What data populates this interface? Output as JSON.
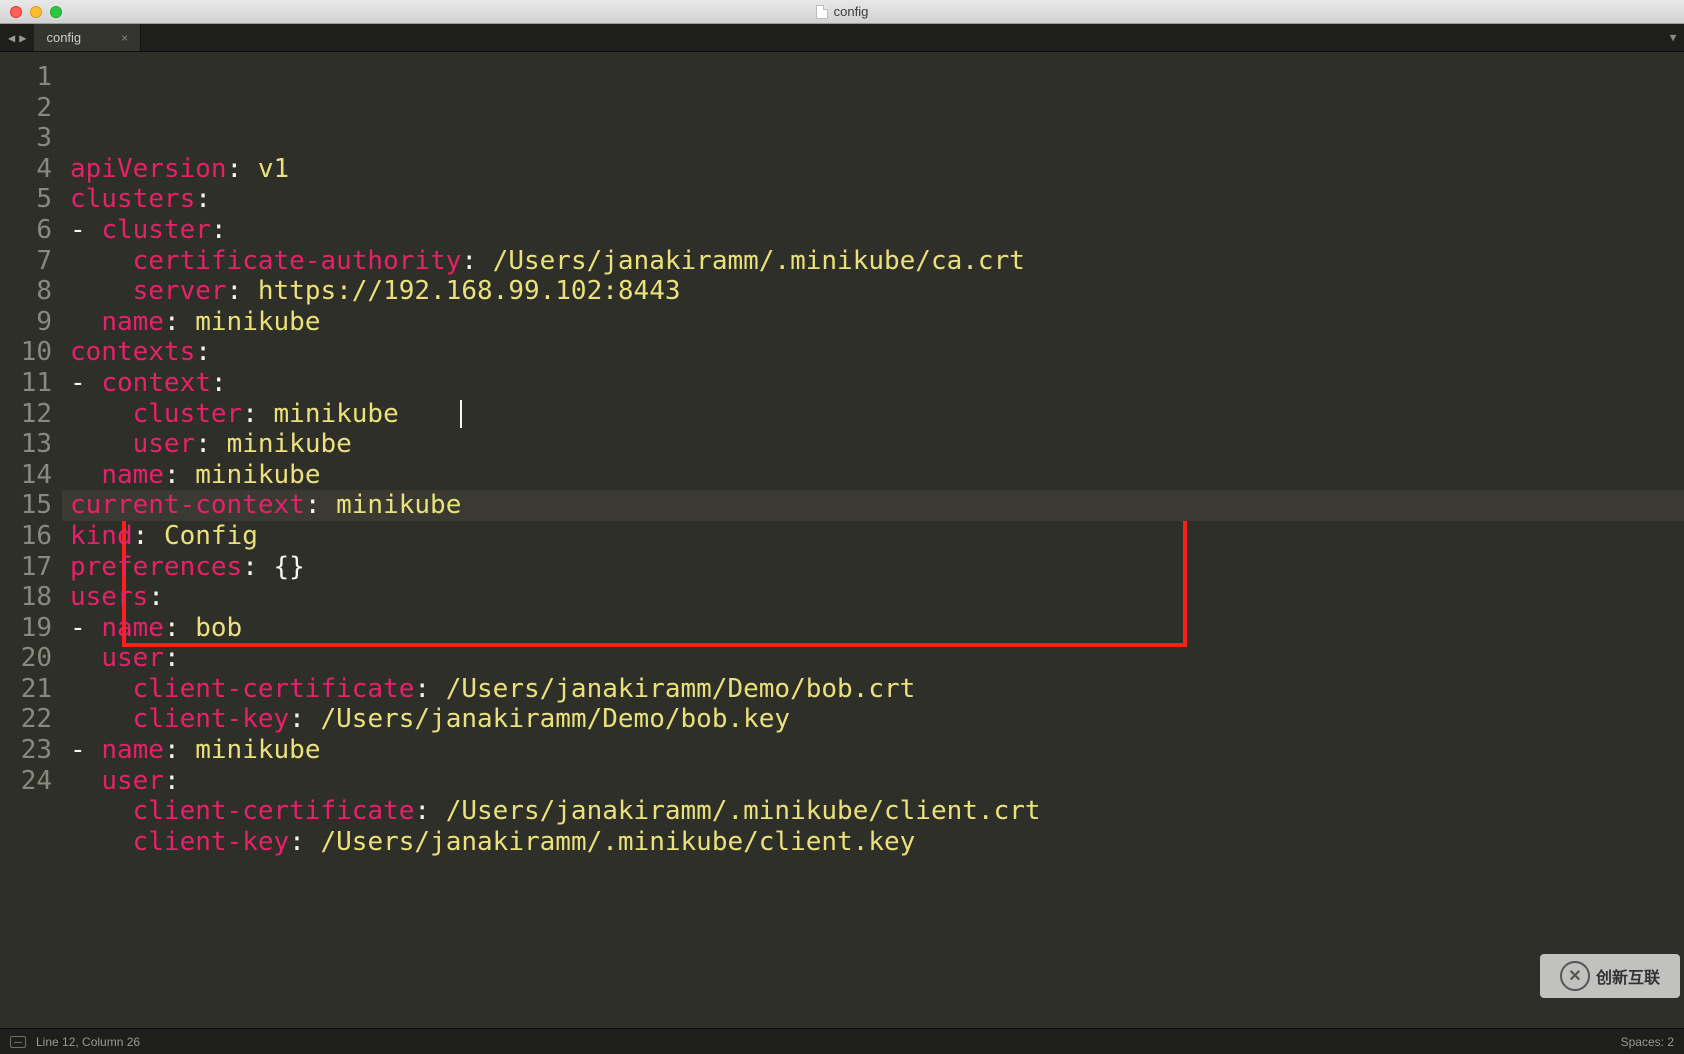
{
  "window": {
    "title": "config"
  },
  "tabs": [
    {
      "label": "config",
      "close": "×"
    }
  ],
  "nav": {
    "left": "◀",
    "right": "▶",
    "dropdown": "▼"
  },
  "lines": [
    {
      "n": "1",
      "segs": [
        [
          "k",
          "apiVersion"
        ],
        [
          "p",
          ": "
        ],
        [
          "s",
          "v1"
        ]
      ]
    },
    {
      "n": "2",
      "segs": [
        [
          "k",
          "clusters"
        ],
        [
          "p",
          ":"
        ]
      ]
    },
    {
      "n": "3",
      "segs": [
        [
          "d",
          "- "
        ],
        [
          "k",
          "cluster"
        ],
        [
          "p",
          ":"
        ]
      ]
    },
    {
      "n": "4",
      "segs": [
        [
          "p",
          "    "
        ],
        [
          "k",
          "certificate-authority"
        ],
        [
          "p",
          ": "
        ],
        [
          "s",
          "/Users/janakiramm/.minikube/ca.crt"
        ]
      ]
    },
    {
      "n": "5",
      "segs": [
        [
          "p",
          "    "
        ],
        [
          "k",
          "server"
        ],
        [
          "p",
          ": "
        ],
        [
          "s",
          "https://192.168.99.102:8443"
        ]
      ]
    },
    {
      "n": "6",
      "segs": [
        [
          "p",
          "  "
        ],
        [
          "k",
          "name"
        ],
        [
          "p",
          ": "
        ],
        [
          "s",
          "minikube"
        ]
      ]
    },
    {
      "n": "7",
      "segs": [
        [
          "k",
          "contexts"
        ],
        [
          "p",
          ":"
        ]
      ]
    },
    {
      "n": "8",
      "segs": [
        [
          "d",
          "- "
        ],
        [
          "k",
          "context"
        ],
        [
          "p",
          ":"
        ]
      ]
    },
    {
      "n": "9",
      "segs": [
        [
          "p",
          "    "
        ],
        [
          "k",
          "cluster"
        ],
        [
          "p",
          ": "
        ],
        [
          "s",
          "minikube"
        ]
      ]
    },
    {
      "n": "10",
      "segs": [
        [
          "p",
          "    "
        ],
        [
          "k",
          "user"
        ],
        [
          "p",
          ": "
        ],
        [
          "s",
          "minikube"
        ]
      ]
    },
    {
      "n": "11",
      "segs": [
        [
          "p",
          "  "
        ],
        [
          "k",
          "name"
        ],
        [
          "p",
          ": "
        ],
        [
          "s",
          "minikube"
        ]
      ]
    },
    {
      "n": "12",
      "segs": [
        [
          "k",
          "current-context"
        ],
        [
          "p",
          ": "
        ],
        [
          "s",
          "minikube"
        ]
      ],
      "current": true
    },
    {
      "n": "13",
      "segs": [
        [
          "k",
          "kind"
        ],
        [
          "p",
          ": "
        ],
        [
          "s",
          "Config"
        ]
      ]
    },
    {
      "n": "14",
      "segs": [
        [
          "k",
          "preferences"
        ],
        [
          "p",
          ": "
        ],
        [
          "br",
          "{}"
        ]
      ]
    },
    {
      "n": "15",
      "segs": [
        [
          "k",
          "users"
        ],
        [
          "p",
          ":"
        ]
      ]
    },
    {
      "n": "16",
      "segs": [
        [
          "d",
          "- "
        ],
        [
          "k",
          "name"
        ],
        [
          "p",
          ": "
        ],
        [
          "s",
          "bob"
        ]
      ]
    },
    {
      "n": "17",
      "segs": [
        [
          "p",
          "  "
        ],
        [
          "k",
          "user"
        ],
        [
          "p",
          ":"
        ]
      ]
    },
    {
      "n": "18",
      "segs": [
        [
          "p",
          "    "
        ],
        [
          "k",
          "client-certificate"
        ],
        [
          "p",
          ": "
        ],
        [
          "s",
          "/Users/janakiramm/Demo/bob.crt"
        ]
      ]
    },
    {
      "n": "19",
      "segs": [
        [
          "p",
          "    "
        ],
        [
          "k",
          "client-key"
        ],
        [
          "p",
          ": "
        ],
        [
          "s",
          "/Users/janakiramm/Demo/bob.key"
        ]
      ]
    },
    {
      "n": "20",
      "segs": [
        [
          "d",
          "- "
        ],
        [
          "k",
          "name"
        ],
        [
          "p",
          ": "
        ],
        [
          "s",
          "minikube"
        ]
      ]
    },
    {
      "n": "21",
      "segs": [
        [
          "p",
          "  "
        ],
        [
          "k",
          "user"
        ],
        [
          "p",
          ":"
        ]
      ]
    },
    {
      "n": "22",
      "segs": [
        [
          "p",
          "    "
        ],
        [
          "k",
          "client-certificate"
        ],
        [
          "p",
          ": "
        ],
        [
          "s",
          "/Users/janakiramm/.minikube/client.crt"
        ]
      ]
    },
    {
      "n": "23",
      "segs": [
        [
          "p",
          "    "
        ],
        [
          "k",
          "client-key"
        ],
        [
          "p",
          ": "
        ],
        [
          "s",
          "/Users/janakiramm/.minikube/client.key"
        ]
      ]
    },
    {
      "n": "24",
      "segs": [
        [
          "p",
          ""
        ]
      ]
    }
  ],
  "highlight": {
    "startLine": 16,
    "endLine": 19
  },
  "cursor": {
    "line": 12,
    "col": 26
  },
  "status": {
    "position": "Line 12, Column 26",
    "spaces": "Spaces: 2"
  },
  "watermark": {
    "text": "创新互联"
  }
}
